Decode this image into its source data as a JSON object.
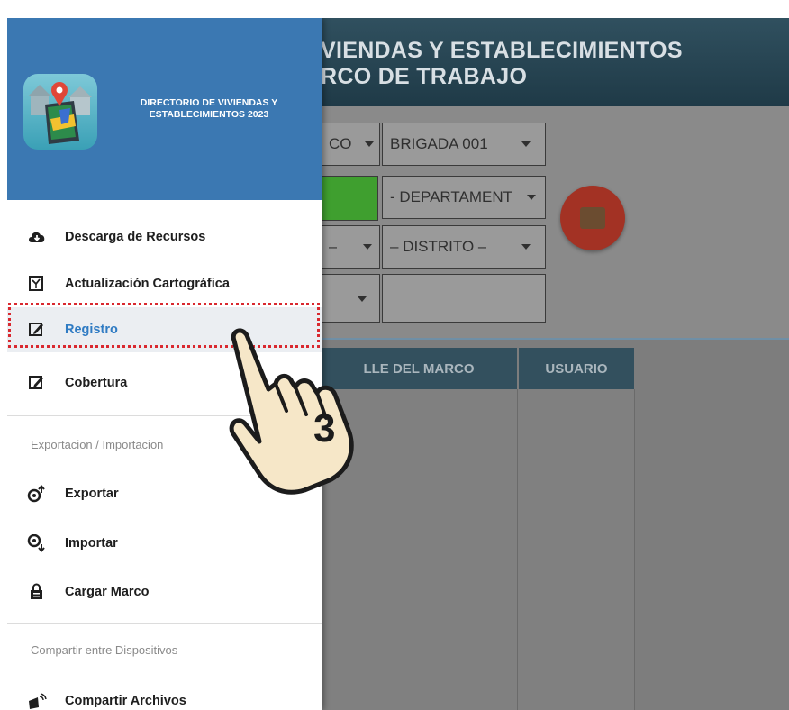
{
  "app": {
    "title_line1": "VIENDAS Y ESTABLECIMIENTOS",
    "title_line2": "RCO DE TRABAJO"
  },
  "filters": {
    "row1_left": "CO",
    "brigada": "BRIGADA 001",
    "departamento": "- DEPARTAMENT",
    "row3_left": "– ",
    "distrito": "– DISTRITO –"
  },
  "table": {
    "columns": [
      "LLE DEL MARCO",
      "USUARIO"
    ]
  },
  "drawer": {
    "brand_line1": "DIRECTORIO DE VIVIENDAS Y",
    "brand_line2": "ESTABLECIMIENTOS 2023",
    "items": [
      {
        "label": "Descarga de Recursos",
        "icon": "cloud-download-icon"
      },
      {
        "label": "Actualización Cartográfica",
        "icon": "map-update-icon"
      },
      {
        "label": "Registro",
        "icon": "edit-icon"
      },
      {
        "label": "Cobertura",
        "icon": "edit-icon"
      }
    ],
    "section1": "Exportacion / Importacion",
    "items2": [
      {
        "label": "Exportar",
        "icon": "export-icon"
      },
      {
        "label": "Importar",
        "icon": "import-icon"
      },
      {
        "label": "Cargar Marco",
        "icon": "lock-icon"
      }
    ],
    "section2": "Compartir entre Dispositivos",
    "items3": [
      {
        "label": "Compartir Archivos",
        "icon": "share-files-icon"
      }
    ]
  },
  "annotation": {
    "step_number": "3"
  },
  "colors": {
    "drawer_header": "#3b78b2",
    "highlight_border": "#d9282f",
    "active_label": "#2f7bc3"
  }
}
